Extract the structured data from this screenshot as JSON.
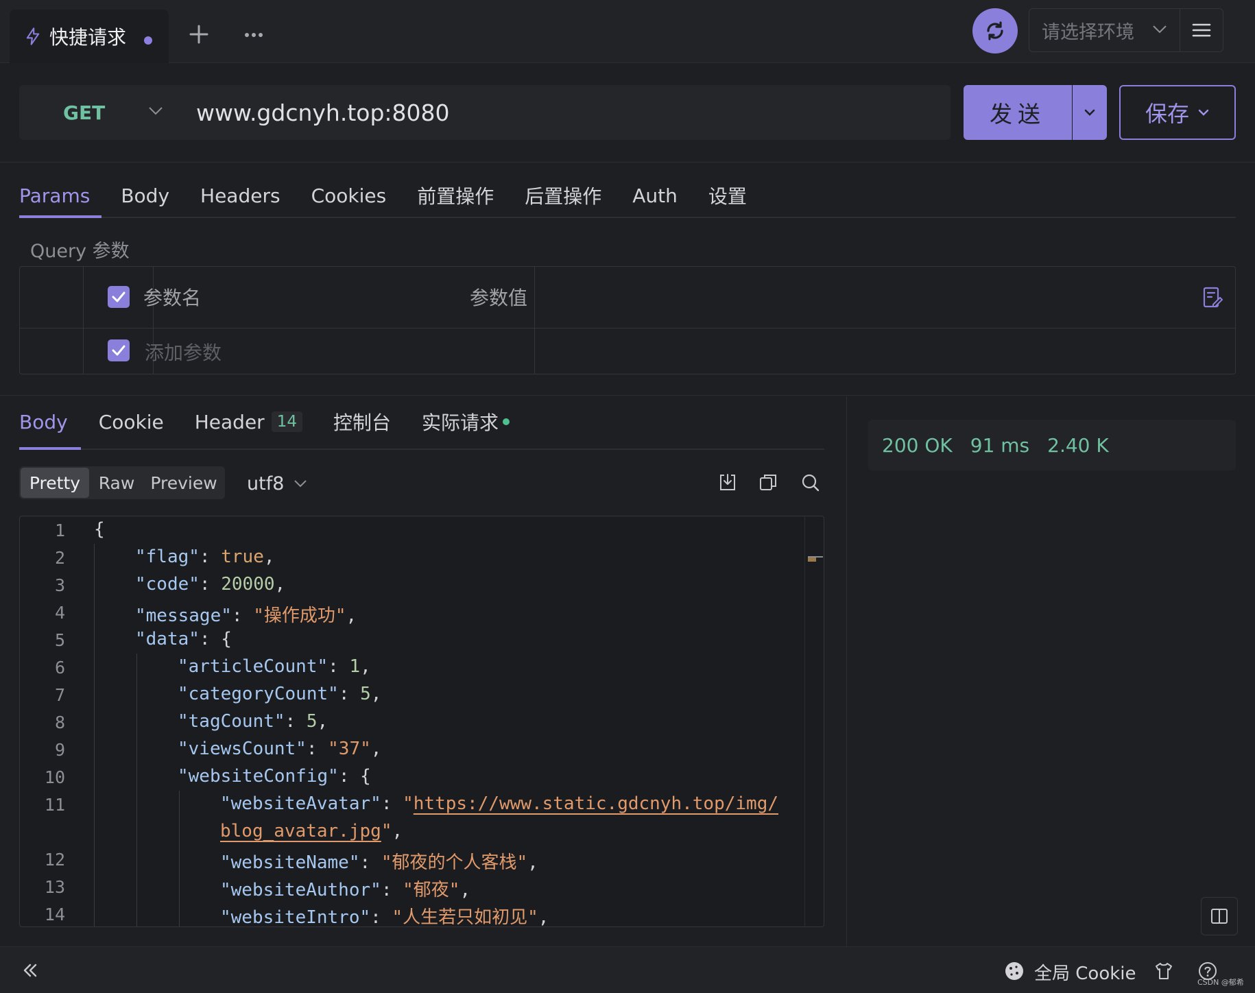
{
  "tabbar": {
    "tab_title": "快捷请求",
    "env_placeholder": "请选择环境"
  },
  "request": {
    "method": "GET",
    "url": "www.gdcnyh.top:8080",
    "send_label": "发送",
    "save_label": "保存"
  },
  "request_tabs": [
    "Params",
    "Body",
    "Headers",
    "Cookies",
    "前置操作",
    "后置操作",
    "Auth",
    "设置"
  ],
  "active_request_tab": "Params",
  "params": {
    "section_label": "Query 参数",
    "col_name": "参数名",
    "col_value": "参数值",
    "add_placeholder": "添加参数"
  },
  "response_tabs": {
    "body": "Body",
    "cookie": "Cookie",
    "header": "Header",
    "header_count": "14",
    "console": "控制台",
    "actual_request": "实际请求"
  },
  "active_response_tab": "Body",
  "view_modes": [
    "Pretty",
    "Raw",
    "Preview"
  ],
  "active_view_mode": "Pretty",
  "encoding": "utf8",
  "code": {
    "line_numbers": [
      "1",
      "2",
      "3",
      "4",
      "5",
      "6",
      "7",
      "8",
      "9",
      "10",
      "11",
      "",
      "12",
      "13",
      "14"
    ],
    "l1": "{",
    "l2_key": "\"flag\"",
    "l2_val": "true",
    "l3_key": "\"code\"",
    "l3_val": "20000",
    "l4_key": "\"message\"",
    "l4_val": "\"操作成功\"",
    "l5_key": "\"data\"",
    "l5_rest": ": {",
    "l6_key": "\"articleCount\"",
    "l6_val": "1",
    "l7_key": "\"categoryCount\"",
    "l7_val": "5",
    "l8_key": "\"tagCount\"",
    "l8_val": "5",
    "l9_key": "\"viewsCount\"",
    "l9_val": "\"37\"",
    "l10_key": "\"websiteConfig\"",
    "l10_rest": ": {",
    "l11_key": "\"websiteAvatar\"",
    "l11_q": "\"",
    "l11_val_a": "https://www.static.gdcnyh.top/img/",
    "l11b_val": "blog_avatar.jpg",
    "l11b_q": "\"",
    "l12_key": "\"websiteName\"",
    "l12_val": "\"郁夜的个人客栈\"",
    "l13_key": "\"websiteAuthor\"",
    "l13_val": "\"郁夜\"",
    "l14_key": "\"websiteIntro\"",
    "l14_val": "\"人生若只如初见\""
  },
  "response_meta": {
    "status": "200 OK",
    "time": "91 ms",
    "size": "2.40 K"
  },
  "statusbar": {
    "cookie_label": "全局 Cookie",
    "watermark": "CSDN @郁希"
  },
  "colors": {
    "accent": "#8a7fdb",
    "method_get": "#6fc1a1",
    "status_ok": "#6fc1a1",
    "background": "#1e1f22"
  },
  "icons": [
    "bolt-icon",
    "plus-icon",
    "more-icon",
    "sync-icon",
    "chevron-down-icon",
    "menu-icon",
    "check-icon",
    "bulk-edit-icon",
    "download-icon",
    "copy-icon",
    "search-icon",
    "split-view-icon",
    "collapse-icon",
    "cookie-icon",
    "shirt-icon",
    "help-icon"
  ]
}
